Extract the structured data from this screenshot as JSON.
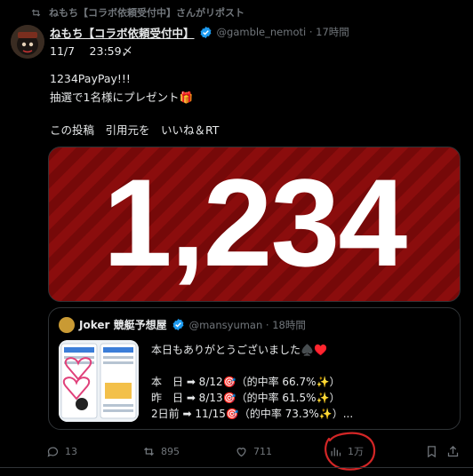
{
  "repost": {
    "text": "ねもち【コラボ依頼受付中】さんがリポスト"
  },
  "post": {
    "display_name": "ねもち【コラボ依頼受付中】",
    "handle_time": "@gamble_nemoti · 17時間",
    "lines": [
      "11/7　 23:59〆",
      "1234PayPay!!!",
      "抽選で1名様にプレゼント🎁",
      "この投稿　引用元を　いいね＆RT"
    ],
    "image_text": "1,234"
  },
  "quote": {
    "display_name": "Joker 競艇予想屋",
    "handle_time": "@mansyuman · 18時間",
    "lines": [
      "本日もありがとうございました♠️♥️",
      "本　日 ➡ 8/12🎯（的中率 66.7%✨）",
      "昨　日 ➡ 8/13🎯（的中率 61.5%✨）",
      "2日前 ➡ 11/15🎯（的中率 73.3%✨）..."
    ]
  },
  "actions": {
    "replies": "13",
    "reposts": "895",
    "likes": "711",
    "views": "1万"
  },
  "colors": {
    "background": "#000000",
    "text": "#e7e9ea",
    "muted": "#71767b",
    "verified": "#1d9bf0",
    "banner": "#8b0d0d",
    "annotation": "#d32626"
  }
}
